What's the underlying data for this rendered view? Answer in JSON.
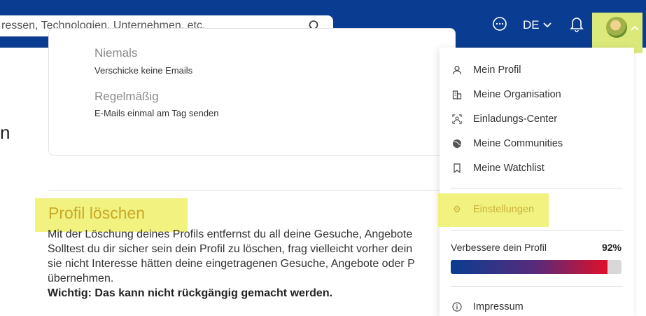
{
  "header": {
    "search_placeholder": "ressen, Technologien, Unternehmen, etc.",
    "language": "DE",
    "icons": [
      "search-icon",
      "chat-icon",
      "chevron-down-icon",
      "bell-icon",
      "avatar",
      "chevron-up-icon"
    ]
  },
  "email_options": [
    {
      "title": "Niemals",
      "desc": "Verschicke keine Emails"
    },
    {
      "title": "Regelmäßig",
      "desc": "E-Mails einmal am Tag senden"
    }
  ],
  "side_letter": "n",
  "delete_section": {
    "heading": "Profil löschen",
    "lines": [
      "Mit der Löschung deines Profils entfernst du all deine Gesuche, Angebote",
      "Solltest du dir sicher sein dein Profil zu löschen, frag vielleicht vorher dein",
      "sie nicht Interesse hätten deine eingetragenen Gesuche, Angebote oder P",
      "übernehmen."
    ],
    "warning": "Wichtig: Das kann nicht rückgängig gemacht werden."
  },
  "menu": {
    "items": [
      {
        "label": "Mein Profil",
        "icon": "user-icon"
      },
      {
        "label": "Meine Organisation",
        "icon": "building-icon"
      },
      {
        "label": "Einladungs-Center",
        "icon": "invite-icon"
      },
      {
        "label": "Meine Communities",
        "icon": "globe-icon"
      },
      {
        "label": "Meine Watchlist",
        "icon": "bookmark-icon"
      },
      {
        "label": "Einstellungen",
        "icon": "gear-icon"
      }
    ],
    "progress_label": "Verbessere dein Profil",
    "progress_value": "92%",
    "progress_fraction": 0.92,
    "impressum": "Impressum"
  },
  "colors": {
    "brand_blue": "#0a3d91",
    "highlight": "#eef06a",
    "heading": "#c8a928"
  }
}
